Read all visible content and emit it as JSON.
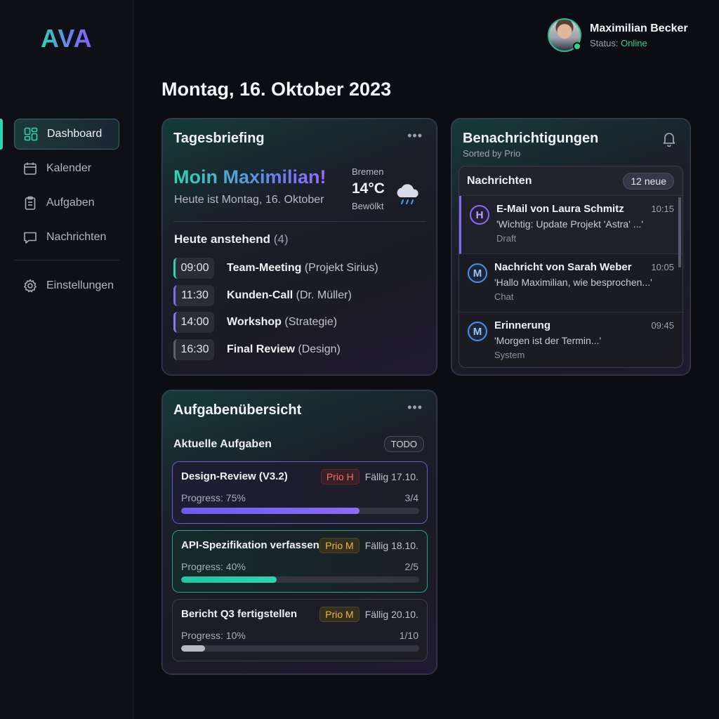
{
  "app": {
    "logo": "AVA"
  },
  "sidebar": {
    "items": [
      {
        "label": "Dashboard",
        "icon": "dashboard-icon"
      },
      {
        "label": "Kalender",
        "icon": "calendar-icon"
      },
      {
        "label": "Aufgaben",
        "icon": "clipboard-icon"
      },
      {
        "label": "Nachrichten",
        "icon": "chat-icon"
      }
    ],
    "settings": {
      "label": "Einstellungen",
      "icon": "gear-icon"
    }
  },
  "user": {
    "name": "Maximilian Becker",
    "status_prefix": "Status:",
    "status_value": "Online"
  },
  "page": {
    "date_title": "Montag, 16. Oktober 2023"
  },
  "briefing": {
    "title": "Tagesbriefing",
    "greeting": "Moin Maximilian!",
    "subtitle": "Heute ist Montag, 16. Oktober",
    "weather": {
      "city": "Bremen",
      "temp": "14°C",
      "desc": "Bewölkt",
      "icon": "rain-cloud-icon"
    },
    "upcoming_label": "Heute anstehend",
    "upcoming_count": "(4)",
    "events": [
      {
        "time": "09:00",
        "title": "Team-Meeting",
        "detail": "(Projekt Sirius)"
      },
      {
        "time": "11:30",
        "title": "Kunden-Call",
        "detail": "(Dr. Müller)"
      },
      {
        "time": "14:00",
        "title": "Workshop",
        "detail": "(Strategie)"
      },
      {
        "time": "16:30",
        "title": "Final Review",
        "detail": "(Design)"
      }
    ]
  },
  "notifications": {
    "title": "Benachrichtigungen",
    "subtitle": "Sorted by Prio",
    "inbox_title": "Nachrichten",
    "new_badge": "12 neue",
    "messages": [
      {
        "avatar": "H",
        "title": "E-Mail von Laura Schmitz",
        "time": "10:15",
        "preview": "'Wichtig: Update Projekt 'Astra' ...'",
        "category": "Draft"
      },
      {
        "avatar": "M",
        "title": "Nachricht von Sarah Weber",
        "time": "10:05",
        "preview": "'Hallo Maximilian, wie besprochen...'",
        "category": "Chat"
      },
      {
        "avatar": "M",
        "title": "Erinnerung",
        "time": "09:45",
        "preview": "'Morgen ist der Termin...'",
        "category": "System"
      }
    ]
  },
  "tasks": {
    "title": "Aufgabenübersicht",
    "subtitle": "Aktuelle Aufgaben",
    "badge": "TODO",
    "items": [
      {
        "title": "Design-Review (V3.2)",
        "prio": "Prio H",
        "due": "Fällig 17.10.",
        "progress_label": "Progress: 75%",
        "progress": 75,
        "count": "3/4"
      },
      {
        "title": "API-Spezifikation verfassen",
        "prio": "Prio M",
        "due": "Fällig 18.10.",
        "progress_label": "Progress: 40%",
        "progress": 40,
        "count": "2/5"
      },
      {
        "title": "Bericht Q3 fertigstellen",
        "prio": "Prio M",
        "due": "Fällig 20.10.",
        "progress_label": "Progress: 10%",
        "progress": 10,
        "count": "1/10"
      }
    ]
  },
  "colors": {
    "accent": "#2fd4b0",
    "purple": "#7c6cf0",
    "online": "#2fd48a",
    "prio_high": "#f07070",
    "prio_medium": "#e6b84a"
  }
}
